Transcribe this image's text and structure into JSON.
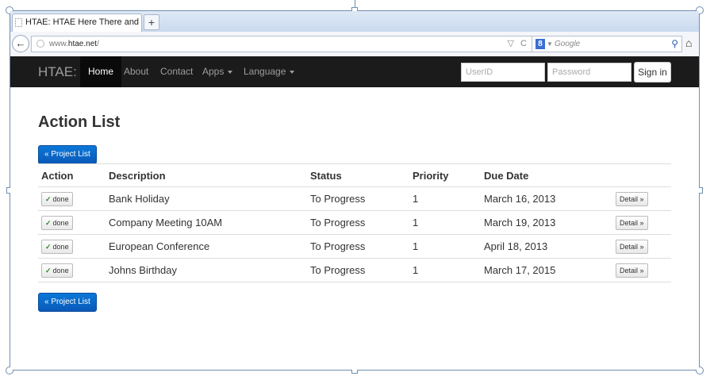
{
  "browser": {
    "tab_title": "HTAE: HTAE Here There and Everywhere...",
    "new_tab_label": "+",
    "url_prefix": "www.",
    "url_domain": "htae.net",
    "url_suffix": "/",
    "search_placeholder": "Google"
  },
  "nav": {
    "brand": "HTAE:",
    "items": [
      {
        "label": "Home",
        "active": true
      },
      {
        "label": "About"
      },
      {
        "label": "Contact"
      },
      {
        "label": "Apps",
        "dropdown": true
      },
      {
        "label": "Language",
        "dropdown": true
      }
    ],
    "userid_placeholder": "UserID",
    "password_placeholder": "Password",
    "signin_label": "Sign in"
  },
  "page": {
    "title": "Action List",
    "project_list_label": "« Project List",
    "table": {
      "headers": [
        "Action",
        "Description",
        "Status",
        "Priority",
        "Due Date",
        ""
      ],
      "done_label": "done",
      "detail_label": "Detail »",
      "rows": [
        {
          "description": "Bank Holiday",
          "status": "To Progress",
          "priority": "1",
          "due": "March 16, 2013"
        },
        {
          "description": "Company Meeting 10AM",
          "status": "To Progress",
          "priority": "1",
          "due": "March 19, 2013"
        },
        {
          "description": "European Conference",
          "status": "To Progress",
          "priority": "1",
          "due": "April 18, 2013"
        },
        {
          "description": "Johns Birthday",
          "status": "To Progress",
          "priority": "1",
          "due": "March 17, 2015"
        }
      ]
    }
  },
  "colors": {
    "navbar_bg": "#1b1b1b",
    "primary_button": "#0a68c8",
    "check_green": "#2d8a2d"
  }
}
